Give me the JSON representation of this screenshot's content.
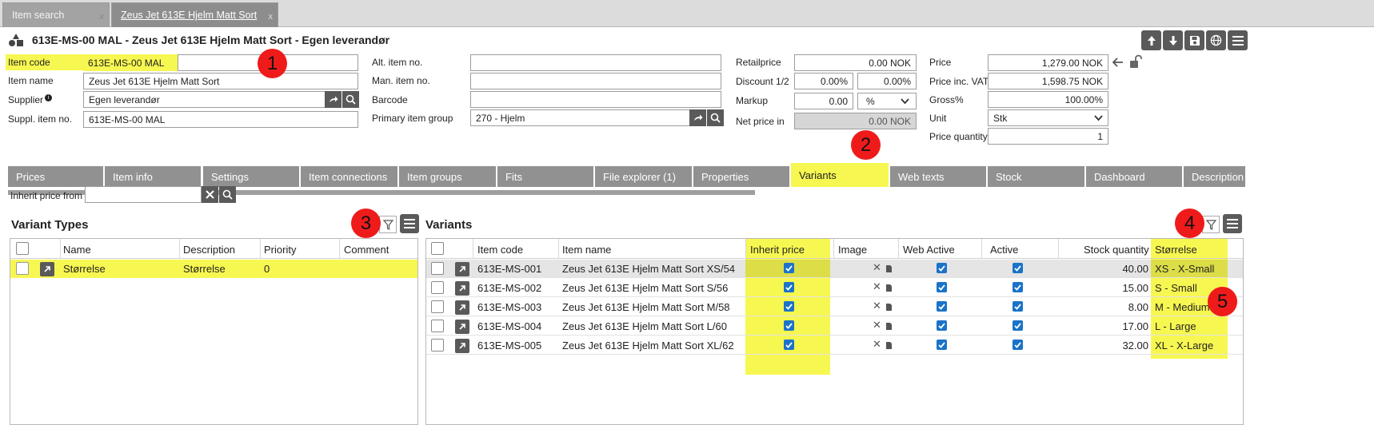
{
  "window_tabs": [
    {
      "label": "Item search",
      "close": "x"
    },
    {
      "label": "Zeus Jet 613E Hjelm Matt Sort",
      "close": "x"
    }
  ],
  "title": "613E-MS-00 MAL - Zeus Jet 613E Hjelm Matt Sort - Egen leverandør",
  "form": {
    "item_code": {
      "label": "Item code",
      "value": "613E-MS-00 MAL"
    },
    "item_name": {
      "label": "Item name",
      "value": "Zeus Jet 613E Hjelm Matt Sort"
    },
    "supplier": {
      "label": "Supplier",
      "value": "Egen leverandør"
    },
    "suppl_item_no": {
      "label": "Suppl. item no.",
      "value": "613E-MS-00 MAL"
    },
    "alt_item_no": {
      "label": "Alt. item no.",
      "value": ""
    },
    "man_item_no": {
      "label": "Man. item no.",
      "value": ""
    },
    "barcode": {
      "label": "Barcode",
      "value": ""
    },
    "primary_item_group": {
      "label": "Primary item group",
      "value": "270 - Hjelm"
    },
    "retailprice": {
      "label": "Retailprice",
      "value": "0.00",
      "unit": "NOK"
    },
    "discount": {
      "label": "Discount 1/2",
      "value1": "0.00%",
      "value2": "0.00%"
    },
    "markup": {
      "label": "Markup",
      "value": "0.00",
      "unit": "%"
    },
    "net_price_in": {
      "label": "Net price in",
      "value": "0.00",
      "unit": "NOK"
    },
    "price": {
      "label": "Price",
      "value": "1,279.00",
      "unit": "NOK"
    },
    "price_inc_vat": {
      "label": "Price inc. VAT",
      "value": "1,598.75",
      "unit": "NOK"
    },
    "gross": {
      "label": "Gross%",
      "value": "100.00%"
    },
    "unit": {
      "label": "Unit",
      "value": "Stk"
    },
    "price_quantity": {
      "label": "Price quantity",
      "value": "1"
    }
  },
  "tabs": [
    "Prices",
    "Item info",
    "Settings",
    "Item connections",
    "Item groups",
    "Fits",
    "File explorer (1)",
    "Properties",
    "Variants",
    "Web texts",
    "Stock",
    "Dashboard",
    "Description"
  ],
  "inherit_price_from": {
    "label": "Inherit price from",
    "value": ""
  },
  "variant_types": {
    "title": "Variant Types",
    "columns": [
      "Name",
      "Description",
      "Priority",
      "Comment"
    ],
    "rows": [
      {
        "name": "Størrelse",
        "description": "Størrelse",
        "priority": "0",
        "comment": ""
      }
    ]
  },
  "variants": {
    "title": "Variants",
    "columns": [
      "Item code",
      "Item name",
      "Inherit price",
      "Image",
      "Web Active",
      "Active",
      "Stock quantity",
      "Størrelse"
    ],
    "rows": [
      {
        "item_code": "613E-MS-001",
        "item_name": "Zeus Jet 613E Hjelm Matt Sort XS/54",
        "inherit_price": true,
        "web_active": true,
        "active": true,
        "stock_quantity": "40.00",
        "size": "XS - X-Small"
      },
      {
        "item_code": "613E-MS-002",
        "item_name": "Zeus Jet 613E Hjelm Matt Sort S/56",
        "inherit_price": true,
        "web_active": true,
        "active": true,
        "stock_quantity": "15.00",
        "size": "S - Small"
      },
      {
        "item_code": "613E-MS-003",
        "item_name": "Zeus Jet 613E Hjelm Matt Sort M/58",
        "inherit_price": true,
        "web_active": true,
        "active": true,
        "stock_quantity": "8.00",
        "size": "M - Medium"
      },
      {
        "item_code": "613E-MS-004",
        "item_name": "Zeus Jet 613E Hjelm Matt Sort L/60",
        "inherit_price": true,
        "web_active": true,
        "active": true,
        "stock_quantity": "17.00",
        "size": "L - Large"
      },
      {
        "item_code": "613E-MS-005",
        "item_name": "Zeus Jet 613E Hjelm Matt Sort XL/62",
        "inherit_price": true,
        "web_active": true,
        "active": true,
        "stock_quantity": "32.00",
        "size": "XL - X-Large"
      }
    ]
  },
  "badges": [
    "1",
    "2",
    "3",
    "4",
    "5"
  ],
  "colors": {
    "highlight": "#f7f751",
    "badge": "#ef1b1b",
    "dark_button": "#5a5a5a",
    "tab": "#919191",
    "check": "#1a73c8"
  }
}
